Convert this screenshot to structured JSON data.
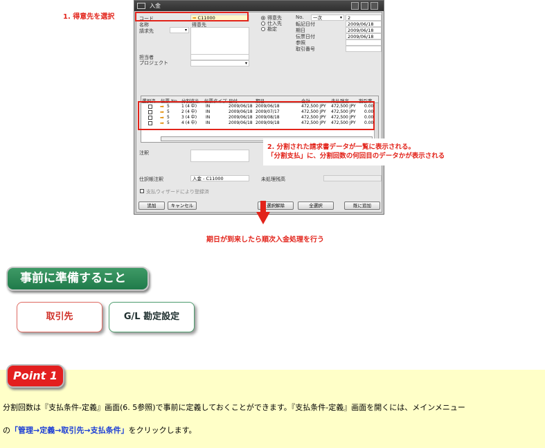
{
  "annotations": {
    "step1": "1. 得意先を選択",
    "step2_line1": "2. 分割された請求書データが一覧に表示される。",
    "step2_line2": "「分割支払」に、分割回数の何回目のデータかが表示される",
    "step3": "期日が到来したら順次入金処理を行う"
  },
  "window": {
    "title": "入金",
    "labels": {
      "code": "コード",
      "name": "名称",
      "bill_to": "請求先",
      "contact": "担当者",
      "project": "プロジェクト",
      "customer": "得意先",
      "vendor": "仕入先",
      "account": "勘定",
      "no": "No.",
      "posting_date": "転記日付",
      "due_date": "期日",
      "doc_date": "伝票日付",
      "reference": "参照",
      "trans_no": "取引番号",
      "remarks": "注釈",
      "journal_remarks": "仕訳帳注釈",
      "wizard": "支払ウィザードにより登録済",
      "unapplied": "未処理残高"
    },
    "values": {
      "code": "C11000",
      "name": "得意先",
      "series": "一次",
      "no": "2",
      "posting_date": "2009/06/18",
      "due_date": "2009/06/18",
      "doc_date": "2009/06/18",
      "journal": "入金 - C11000"
    },
    "grid": {
      "headers": [
        "選択済",
        "伝票 No.",
        "分割支払",
        "伝票タイプ",
        "日付",
        "期日",
        "",
        "合計",
        "未払残高",
        "割引率"
      ],
      "rows": [
        {
          "doc": "5",
          "inst": "1 (4 中)",
          "type": "IN",
          "date": "2009/06/18",
          "due": "2009/06/18",
          "total": "472,500 JPY",
          "bal": "472,500 JPY",
          "disc": "0.00"
        },
        {
          "doc": "5",
          "inst": "2 (4 中)",
          "type": "IN",
          "date": "2009/06/18",
          "due": "2009/07/17",
          "total": "472,500 JPY",
          "bal": "472,500 JPY",
          "disc": "0.00"
        },
        {
          "doc": "5",
          "inst": "3 (4 中)",
          "type": "IN",
          "date": "2009/06/18",
          "due": "2009/08/18",
          "total": "472,500 JPY",
          "bal": "472,500 JPY",
          "disc": "0.00"
        },
        {
          "doc": "5",
          "inst": "4 (4 中)",
          "type": "IN",
          "date": "2009/06/18",
          "due": "2009/09/18",
          "total": "472,500 JPY",
          "bal": "472,500 JPY",
          "disc": "0.00"
        }
      ]
    },
    "buttons": {
      "add": "追加",
      "cancel": "キャンセル",
      "deselect": "選択解除",
      "select_all": "全選択",
      "add_next": "既に追加"
    }
  },
  "section": {
    "heading": "事前に準備すること",
    "card1": "取引先",
    "card2": "G/L 勘定設定"
  },
  "point": {
    "badge": "Point 1",
    "text1": "分割回数は『支払条件-定義』画面(6. 5参照)で事前に定義しておくことができます。『支払条件-定義』画面を開くには、メインメニュー",
    "text2_pre": "の",
    "text2_link": "「管理→定義→取引先→支払条件」",
    "text2_post": "をクリックします。"
  },
  "colors": {
    "accent_red": "#e2231a",
    "section_green": "#2a8a55",
    "point_bg": "#ffffc8",
    "link_blue": "#1a3cd6"
  }
}
